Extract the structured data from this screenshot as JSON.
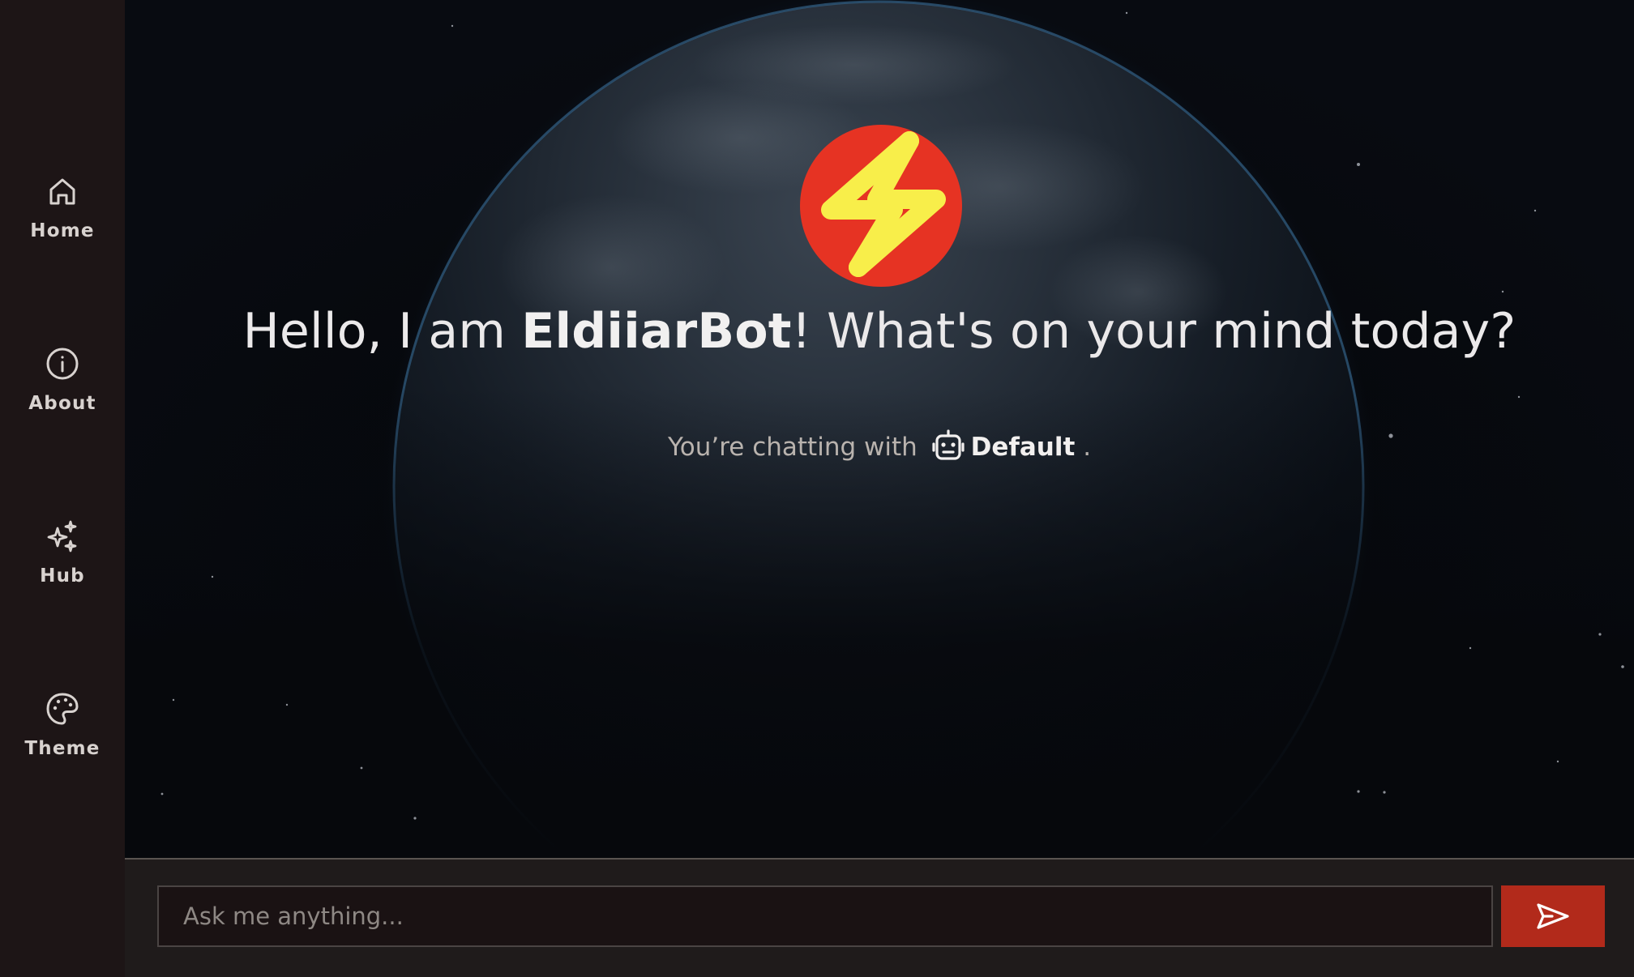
{
  "sidebar": {
    "items": [
      {
        "label": "Home",
        "icon": "home-icon"
      },
      {
        "label": "About",
        "icon": "info-icon"
      },
      {
        "label": "Hub",
        "icon": "sparkles-icon"
      },
      {
        "label": "Theme",
        "icon": "palette-icon"
      }
    ]
  },
  "hero": {
    "logo_icon": "lightning-bolt-icon",
    "greeting_prefix": "Hello, I am ",
    "bot_name": "EldiiarBot",
    "greeting_suffix": "! What's on your mind today?",
    "chatting_prefix": "You’re chatting with",
    "model_icon": "robot-icon",
    "model_name": "Default",
    "chatting_suffix": "."
  },
  "composer": {
    "placeholder": "Ask me anything...",
    "value": "",
    "send_icon": "send-icon"
  },
  "colors": {
    "sidebar_bg": "#1d1516",
    "accent_red": "#b22a1b",
    "logo_red": "#e63323",
    "logo_yellow": "#f8ee4a"
  }
}
